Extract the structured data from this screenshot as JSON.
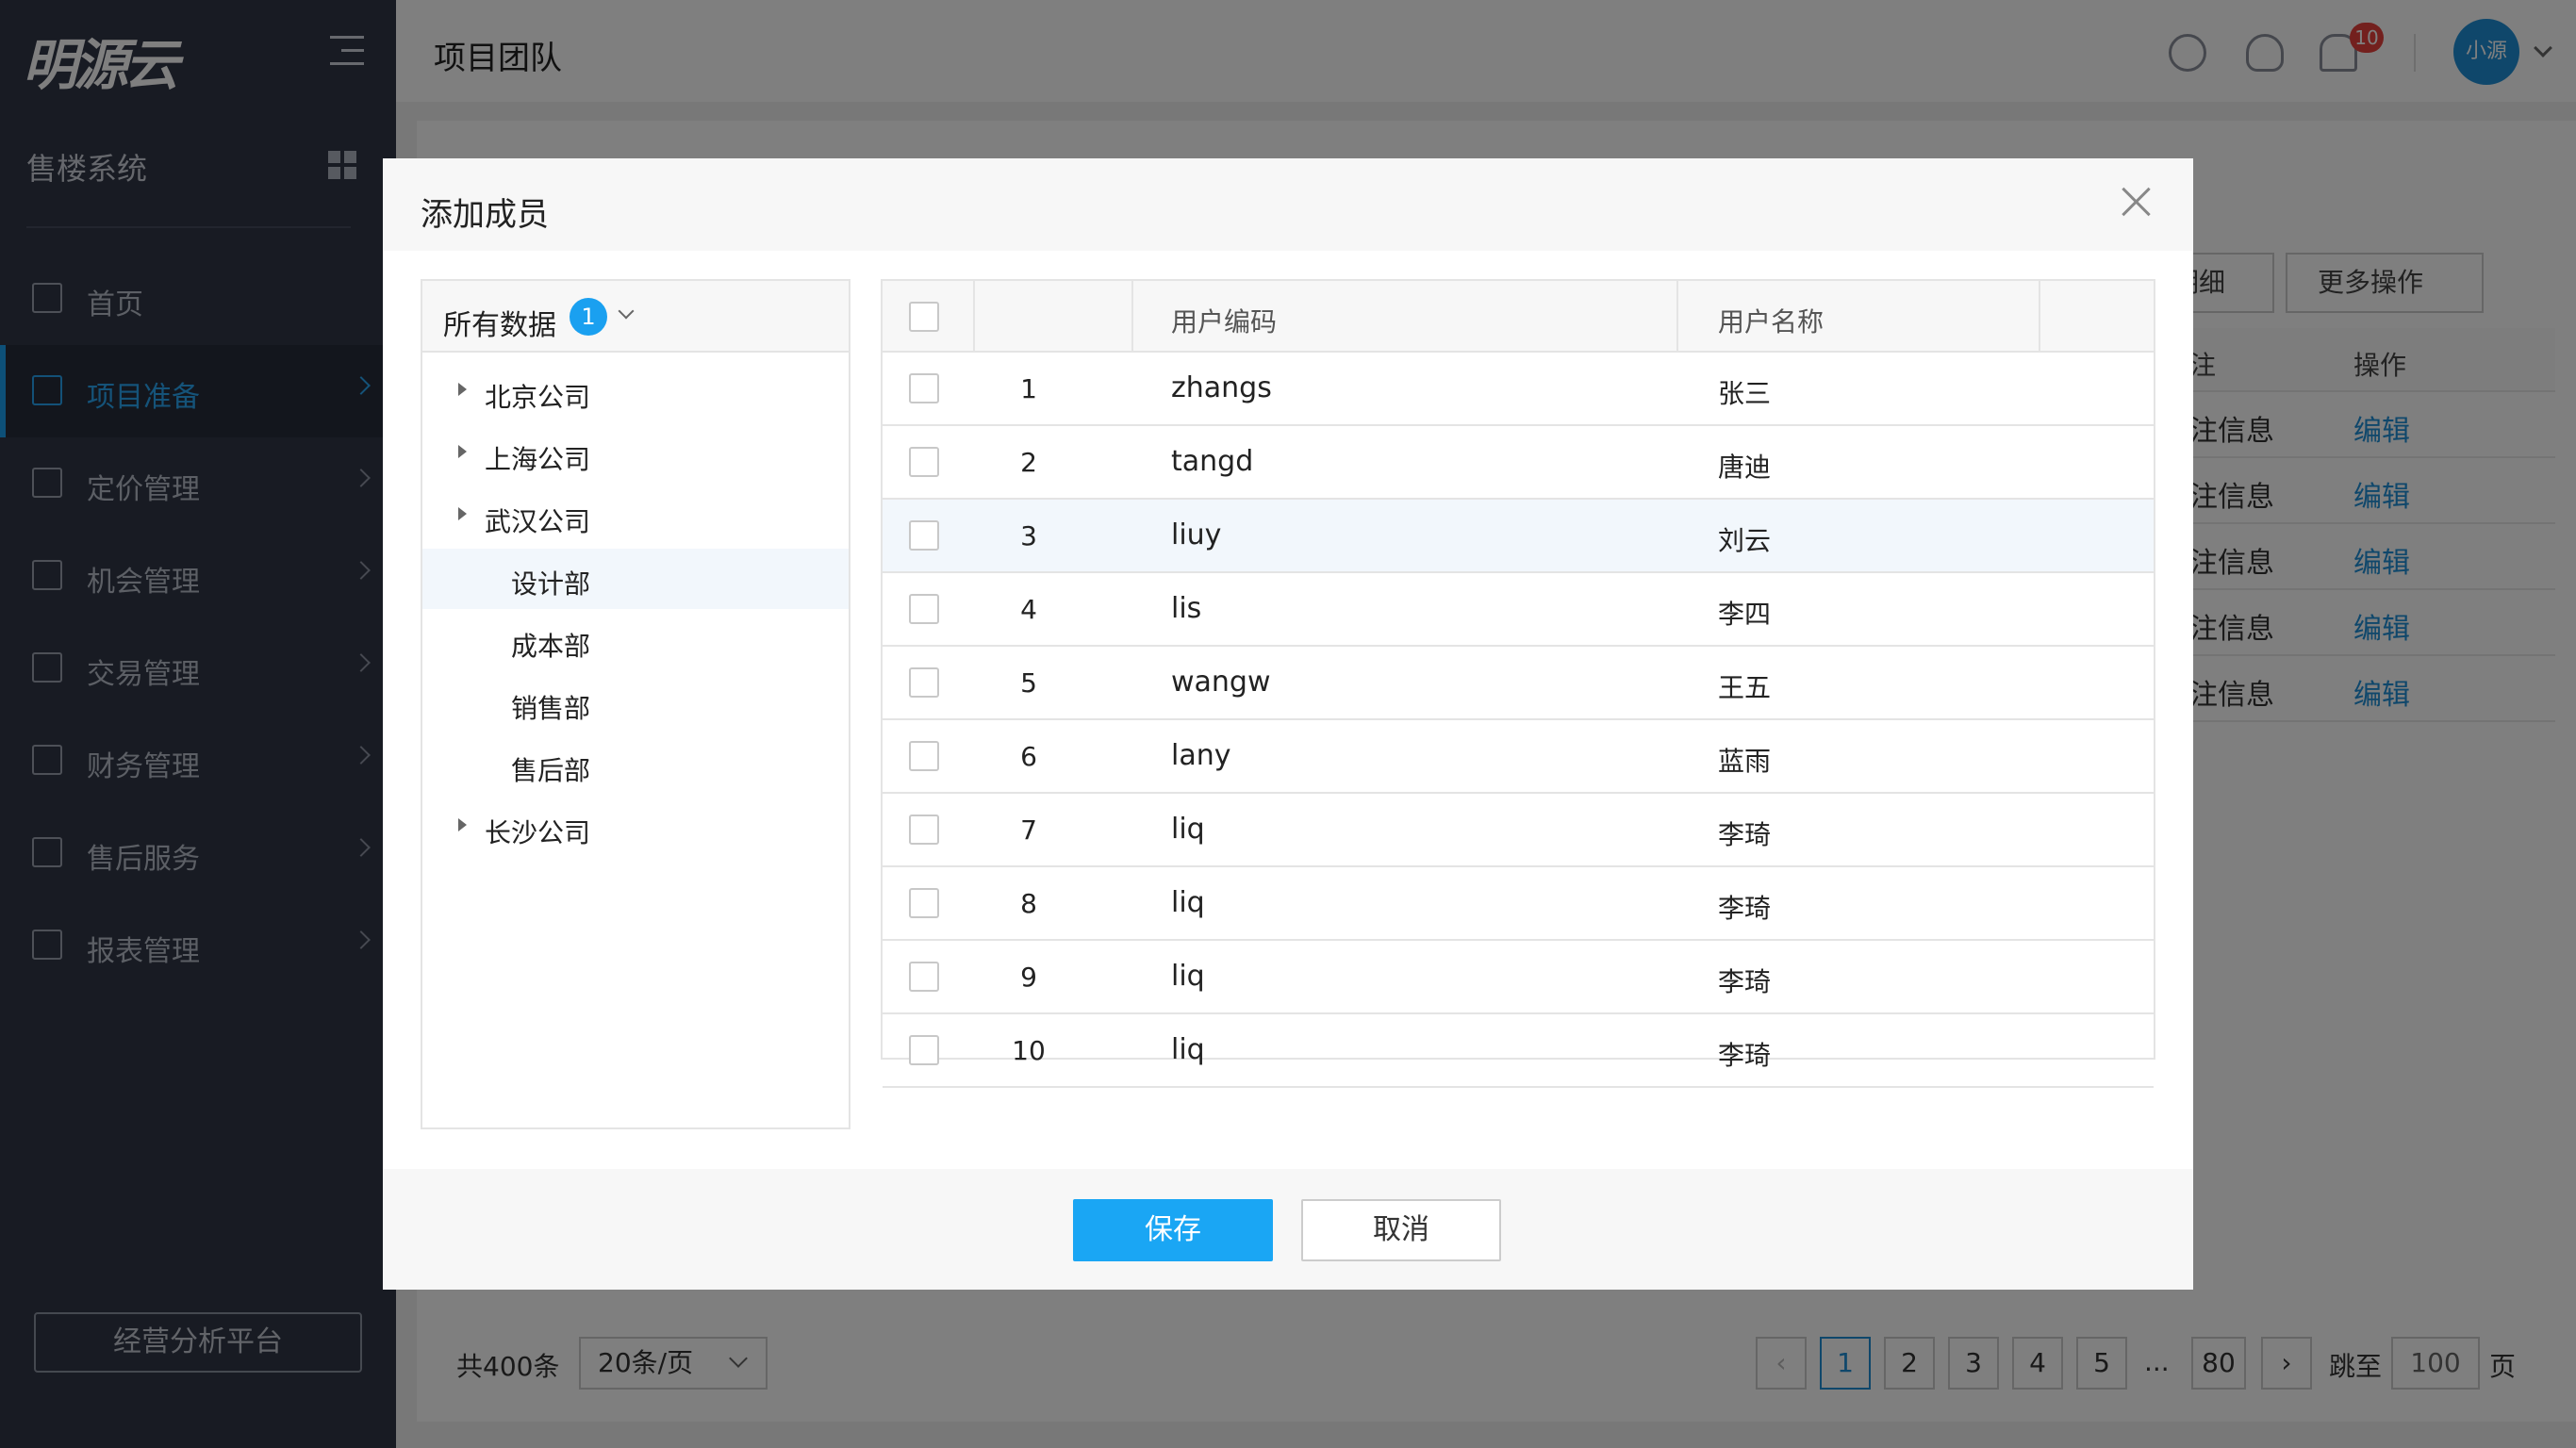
{
  "app": {
    "logo": "明源云",
    "system_name": "售楼系统",
    "bottom_button": "经营分析平台"
  },
  "menu": [
    {
      "label": "首页",
      "active": false,
      "arrow": false
    },
    {
      "label": "项目准备",
      "active": true,
      "arrow": true
    },
    {
      "label": "定价管理",
      "active": false,
      "arrow": true
    },
    {
      "label": "机会管理",
      "active": false,
      "arrow": true
    },
    {
      "label": "交易管理",
      "active": false,
      "arrow": true
    },
    {
      "label": "财务管理",
      "active": false,
      "arrow": true
    },
    {
      "label": "售后服务",
      "active": false,
      "arrow": true
    },
    {
      "label": "报表管理",
      "active": false,
      "arrow": true
    }
  ],
  "header": {
    "title": "项目团队",
    "notification_count": "10",
    "user": "小源"
  },
  "background": {
    "buttons": [
      "明细",
      "更多操作"
    ],
    "table_headers": [
      "注",
      "操作"
    ],
    "rows": [
      {
        "note": "注信息",
        "action": "编辑"
      },
      {
        "note": "注信息",
        "action": "编辑"
      },
      {
        "note": "注信息",
        "action": "编辑"
      },
      {
        "note": "注信息",
        "action": "编辑"
      },
      {
        "note": "注信息",
        "action": "编辑"
      }
    ]
  },
  "pagination": {
    "total": "共400条",
    "page_size": "20条/页",
    "pages": [
      "1",
      "2",
      "3",
      "4",
      "5"
    ],
    "current": "1",
    "ellipsis": "...",
    "last": "80",
    "jump_label": "跳至",
    "jump_value": "100",
    "page_unit": "页"
  },
  "dialog": {
    "title": "添加成员",
    "tree": {
      "title": "所有数据",
      "badge": "1",
      "nodes": [
        {
          "label": "北京公司",
          "level": 0,
          "expandable": true
        },
        {
          "label": "上海公司",
          "level": 0,
          "expandable": true
        },
        {
          "label": "武汉公司",
          "level": 0,
          "expandable": true
        },
        {
          "label": "设计部",
          "level": 1,
          "expandable": false,
          "selected": true
        },
        {
          "label": "成本部",
          "level": 1,
          "expandable": false
        },
        {
          "label": "销售部",
          "level": 1,
          "expandable": false
        },
        {
          "label": "售后部",
          "level": 1,
          "expandable": false
        },
        {
          "label": "长沙公司",
          "level": 0,
          "expandable": true
        }
      ]
    },
    "table": {
      "columns": [
        "用户编码",
        "用户名称"
      ],
      "rows": [
        {
          "no": "1",
          "code": "zhangs",
          "name": "张三"
        },
        {
          "no": "2",
          "code": "tangd",
          "name": "唐迪"
        },
        {
          "no": "3",
          "code": "liuy",
          "name": "刘云",
          "highlight": true
        },
        {
          "no": "4",
          "code": "lis",
          "name": "李四"
        },
        {
          "no": "5",
          "code": "wangw",
          "name": "王五"
        },
        {
          "no": "6",
          "code": "lany",
          "name": "蓝雨"
        },
        {
          "no": "7",
          "code": "liq",
          "name": "李琦"
        },
        {
          "no": "8",
          "code": "liq",
          "name": "李琦"
        },
        {
          "no": "9",
          "code": "liq",
          "name": "李琦"
        },
        {
          "no": "10",
          "code": "liq",
          "name": "李琦"
        }
      ]
    },
    "save_label": "保存",
    "cancel_label": "取消"
  },
  "colors": {
    "sidebar": "#303646",
    "accent": "#1aa0f0",
    "badge": "#e6403c",
    "link": "#1e8fd6"
  }
}
